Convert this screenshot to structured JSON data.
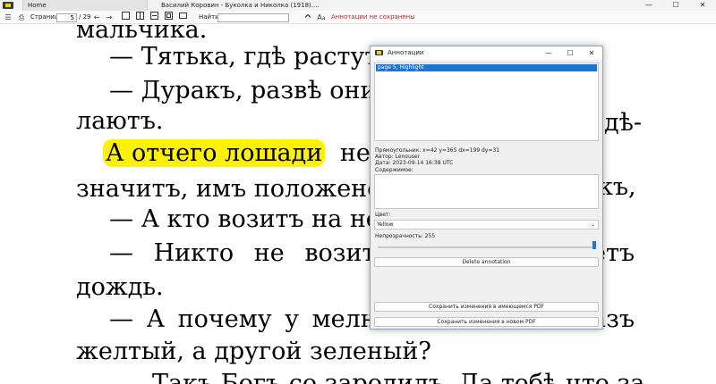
{
  "window": {
    "tab_label": "Home",
    "title": "Василий Коровин - Буколка и Николка (1918)....",
    "minimize": "—",
    "maximize": "☐",
    "close": "✕"
  },
  "toolbar": {
    "menu_icon": "☰",
    "print_icon": "⎙",
    "page_label": "Страница:",
    "page_value": "5",
    "page_total": "/ 29",
    "back_icon": "←",
    "forward_icon": "→",
    "find_label": "Найти:",
    "find_value": "",
    "status": "Аннотации не сохранены"
  },
  "document": {
    "lines": [
      "мальчика.",
      "— Тятька, гдѣ растут",
      "— Дуракъ, развѣ они",
      "лаютъ.",
      "А отчего лошади",
      "значитъ, имъ положено.",
      "— А кто возитъ на не",
      "— Никто не возит",
      "дождь.",
      "— А почему у мелн",
      "желтый, а другой зеленый?",
      "Такъ Богъ со зародилъ. Да тебѣ что за"
    ],
    "right_fragments": [
      "дѣ-",
      "къ,",
      "етъ",
      "азъ"
    ],
    "line4_tail": "не",
    "highlight_text": "А отчего лошади"
  },
  "dialog": {
    "title": "Аннотации",
    "minimize": "—",
    "maximize": "☐",
    "close": "✕",
    "list_items": [
      "page 5, Highlight"
    ],
    "rect": "Прямоугольник: x=42 y=365 dx=199 dy=31",
    "author": "Автор: Lenouser",
    "date": "Дата: 2023-09-14 16:38 UTC",
    "contents_label": "Содержимое:",
    "contents_value": "",
    "color_label": "Цвет:",
    "color_value": "Yellow",
    "opacity_label": "Непрозрачность: 255",
    "opacity_fraction": 1.0,
    "delete_button": "Delete annotation",
    "save_existing": "Сохранить изменения в имеющемся PDF",
    "save_new": "Сохранить изменения в новом PDF"
  },
  "colors": {
    "highlight": "#fff200",
    "accent": "#1c74d4",
    "status": "#d21f1f"
  },
  "icons": [
    "app-icon",
    "menu-icon",
    "print-icon",
    "back-arrow-icon",
    "forward-arrow-icon",
    "single-page-icon",
    "two-page-icon",
    "fit-width-icon",
    "fit-page-icon",
    "zoom-out-icon",
    "zoom-in-icon",
    "text-size-icon"
  ]
}
